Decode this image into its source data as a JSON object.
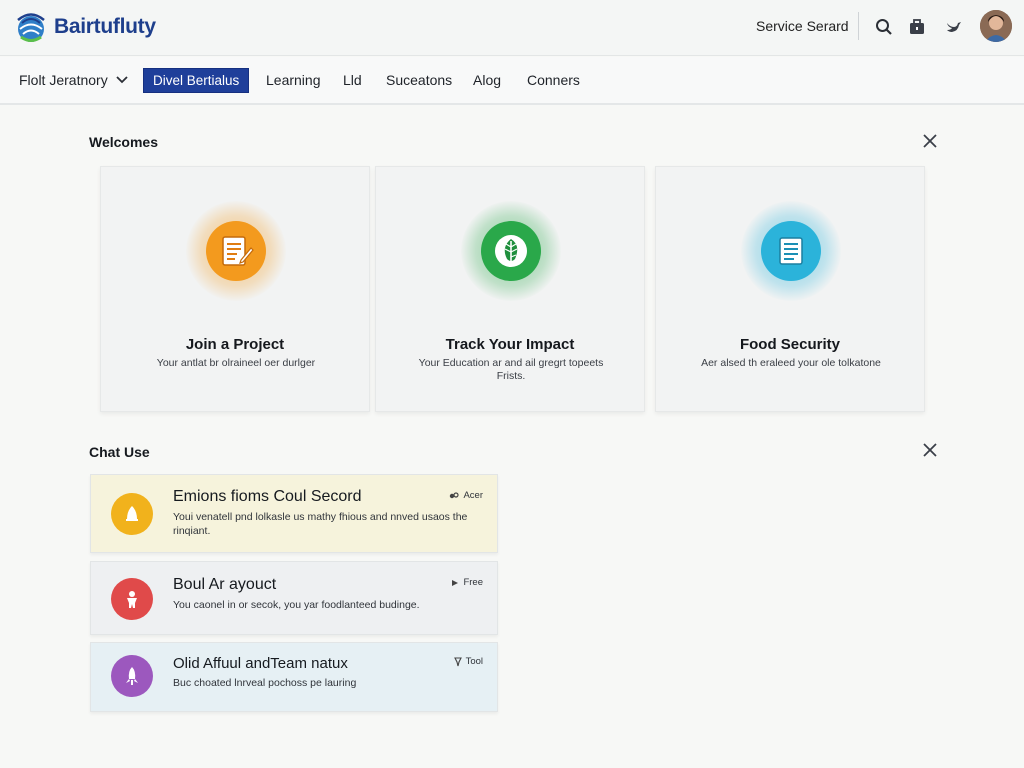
{
  "header": {
    "brand": "Bairtufluty",
    "service_link": "Service Serard",
    "icons": [
      "search-icon",
      "briefcase-icon",
      "bird-icon"
    ]
  },
  "nav": {
    "dropdown_label": "Flolt Jeratnory",
    "items": [
      "Divel Bertialus",
      "Learning",
      "Lld",
      "Suceatons",
      "Alog",
      "Conners"
    ],
    "active_index": 0
  },
  "welcome": {
    "title": "Welcomes",
    "cards": [
      {
        "title": "Join a Project",
        "desc": "Your antlat br olraineel oer durlger",
        "icon": "document-pen-icon",
        "color": "#f39a1e"
      },
      {
        "title": "Track Your Impact",
        "desc": "Your Education ar and ail gregrt topeets Frists.",
        "icon": "leaf-icon",
        "color": "#2aa84a"
      },
      {
        "title": "Food Security",
        "desc": "Aer alsed th eraleed your ole tolkatone",
        "icon": "document-icon",
        "color": "#2bb3da"
      }
    ]
  },
  "chat": {
    "title": "Chat Use",
    "items": [
      {
        "title": "Emions fioms Coul Secord",
        "desc": "Youi venatell pnd lolkasle us mathy fhious and nnved usaos the rinqiant.",
        "tag": "Acer",
        "tag_icon": "handshake-icon",
        "icon": "bell-icon",
        "color": "#f1b21c",
        "bg": "#f6f3dc"
      },
      {
        "title": "Boul Ar ayouct",
        "desc": "You caonel in or secok, you yar foodlanteed budinge.",
        "tag": "Free",
        "tag_icon": "play-icon",
        "icon": "person-icon",
        "color": "#e04a4a",
        "bg": "#eef0f2"
      },
      {
        "title": "Olid Affuul andTeam natux",
        "desc": "Buc choated lnrveal pochoss pe lauring",
        "tag": "Tool",
        "tag_icon": "pin-icon",
        "icon": "rocket-icon",
        "color": "#9c58be",
        "bg": "#e6f0f4"
      }
    ]
  }
}
